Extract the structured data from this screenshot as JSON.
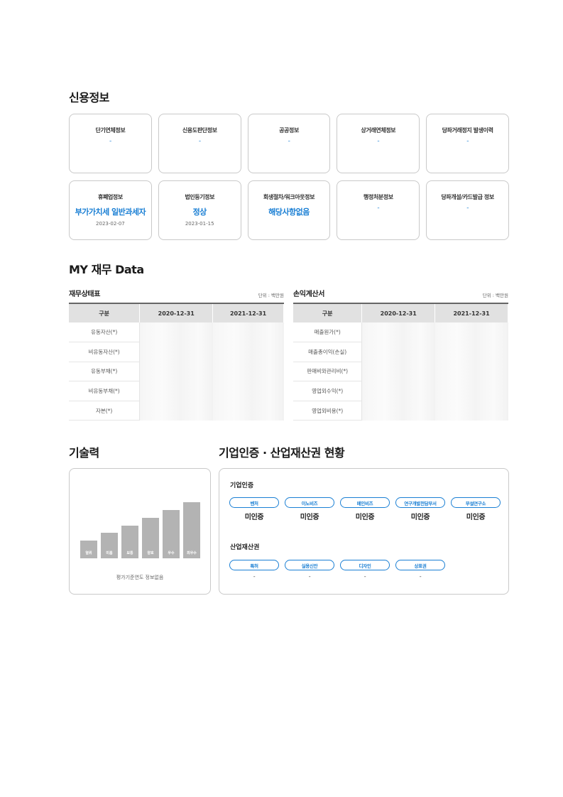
{
  "credit": {
    "title": "신용정보",
    "row1": [
      {
        "title": "단기연체정보",
        "value": "-"
      },
      {
        "title": "신용도판단정보",
        "value": "-"
      },
      {
        "title": "공공정보",
        "value": "-"
      },
      {
        "title": "상거래연체정보",
        "value": "-"
      },
      {
        "title": "당좌거래정지 발생이력",
        "value": "-"
      }
    ],
    "row2": [
      {
        "title": "휴폐업정보",
        "value": "부가가치세 일반과세자",
        "date": "2023-02-07"
      },
      {
        "title": "법인등기정보",
        "value": "정상",
        "date": "2023-01-15"
      },
      {
        "title": "회생절차/워크아웃정보",
        "value": "해당사항없음"
      },
      {
        "title": "행정처분정보",
        "value": "-"
      },
      {
        "title": "당좌개설/카드발급 정보",
        "value": "-"
      }
    ]
  },
  "finance": {
    "title": "MY 재무 Data",
    "balance": {
      "title": "재무상태표",
      "unit": "단위 : 백만원",
      "headers": [
        "구분",
        "2020-12-31",
        "2021-12-31"
      ],
      "rows": [
        "유동자산(*)",
        "비유동자산(*)",
        "유동부채(*)",
        "비유동부채(*)",
        "자본(*)"
      ]
    },
    "income": {
      "title": "손익계산서",
      "unit": "단위 : 백만원",
      "headers": [
        "구분",
        "2020-12-31",
        "2021-12-31"
      ],
      "rows": [
        "매출원가(*)",
        "매출총이익(손실)",
        "판매비와관리비(*)",
        "영업외수익(*)",
        "영업외비용(*)"
      ]
    }
  },
  "tech": {
    "title": "기술력",
    "levels": [
      "열위",
      "미흡",
      "보통",
      "양호",
      "우수",
      "최우수"
    ],
    "note": "평가기준연도 정보없음"
  },
  "cert": {
    "title": "기업인증 · 산업재산권 현황",
    "cert_label": "기업인증",
    "cert_items": [
      {
        "name": "벤처",
        "status": "미인증"
      },
      {
        "name": "이노비즈",
        "status": "미인증"
      },
      {
        "name": "메인비즈",
        "status": "미인증"
      },
      {
        "name": "연구개발전담부서",
        "status": "미인증"
      },
      {
        "name": "부설연구소",
        "status": "미인증"
      }
    ],
    "ip_label": "산업재산권",
    "ip_items": [
      {
        "name": "특허",
        "status": "-"
      },
      {
        "name": "실용신안",
        "status": "-"
      },
      {
        "name": "디자인",
        "status": "-"
      },
      {
        "name": "상표권",
        "status": "-"
      }
    ]
  },
  "colors": {
    "accent": "#1a7fd4",
    "card_border": "#c9c9c9",
    "header_bg": "#e1e1e1",
    "bar": "#b3b3b3"
  }
}
